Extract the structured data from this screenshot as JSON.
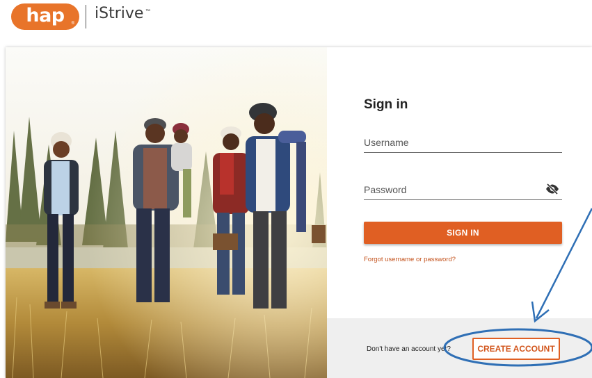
{
  "header": {
    "logo_text": "hap",
    "logo_reg": "®",
    "brand_name": "iStrive",
    "brand_tm": "™"
  },
  "signin": {
    "title": "Sign in",
    "username_placeholder": "Username",
    "password_placeholder": "Password",
    "button_label": "SIGN IN",
    "forgot_link": "Forgot username or password?"
  },
  "footer": {
    "no_account_text": "Don't have an account yet?",
    "create_account_label": "CREATE ACCOUNT"
  },
  "icons": {
    "password_toggle": "eye-slash-icon"
  },
  "colors": {
    "brand_orange": "#e8742a",
    "button_orange": "#e05f23",
    "link_orange": "#c4531d",
    "annotation_blue": "#2f6fb5",
    "footer_gray": "#efefef"
  }
}
